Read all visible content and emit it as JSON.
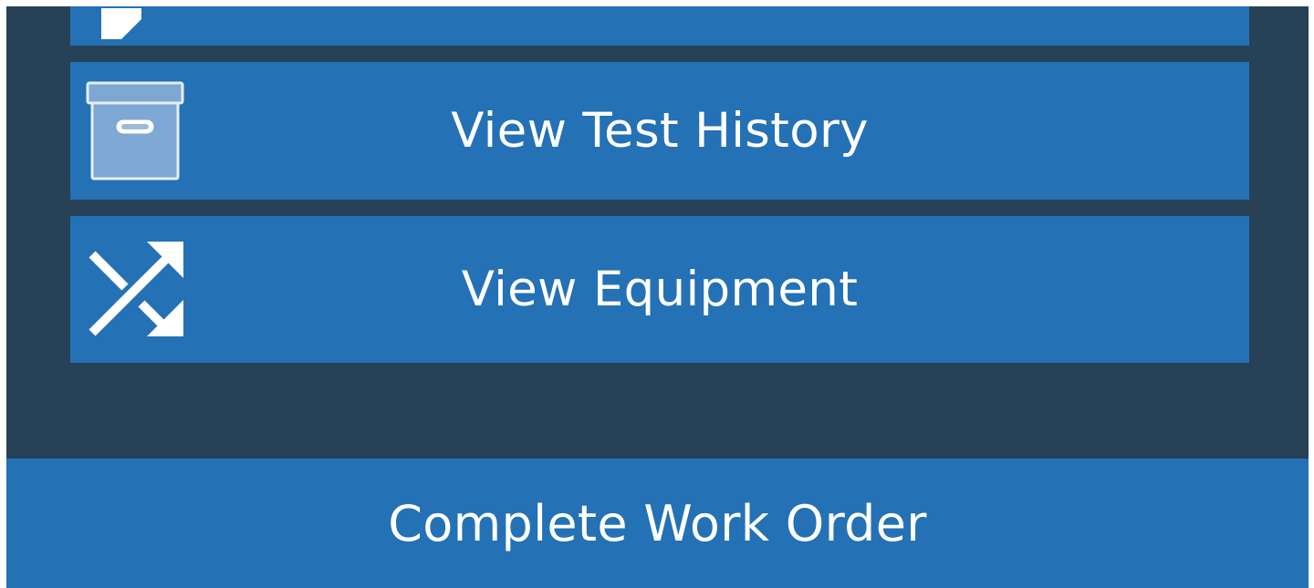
{
  "menu": {
    "items": [
      {
        "label": "",
        "icon": "edit-icon"
      },
      {
        "label": "View Test History",
        "icon": "archive-box-icon"
      },
      {
        "label": "View Equipment",
        "icon": "shuffle-icon"
      }
    ]
  },
  "footer": {
    "complete_label": "Complete Work Order"
  },
  "colors": {
    "background": "#274157",
    "button": "#2471b5",
    "text": "#ffffff"
  }
}
